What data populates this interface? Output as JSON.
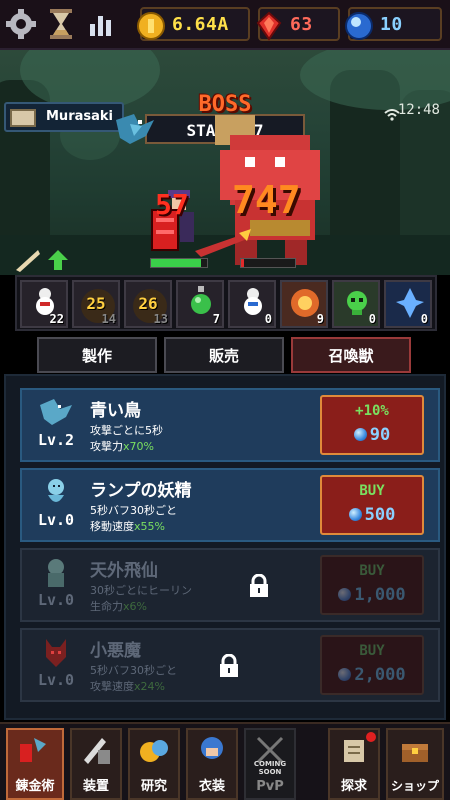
{
  "top_bar": {
    "gold": "6.64A",
    "rubies": "63",
    "gems": "10",
    "icons": [
      "gear-icon",
      "hourglass-icon",
      "stats-icon",
      "gold-coin-icon",
      "ruby-icon",
      "gem-icon"
    ]
  },
  "battle": {
    "player_name": "Murasaki",
    "boss_label": "BOSS",
    "stage_label": "STAGE 17",
    "clock": "12:48",
    "damage_small": "57",
    "damage_large": "747",
    "player_hp_fraction": 0.9,
    "boss_hp_fraction": 0.05
  },
  "items": [
    {
      "name": "snowman-potion",
      "count": "22"
    },
    {
      "name": "gold-coin-25",
      "value": "25",
      "count": "14"
    },
    {
      "name": "gold-coin-26",
      "value": "26",
      "count": "13"
    },
    {
      "name": "green-potion",
      "count": "7"
    },
    {
      "name": "snowman-potion-2",
      "count": "0"
    },
    {
      "name": "fire-scroll",
      "count": "9"
    },
    {
      "name": "skull-scroll",
      "count": "0"
    },
    {
      "name": "ice-scroll",
      "count": "0"
    }
  ],
  "tabs": [
    {
      "label": "製作",
      "active": false
    },
    {
      "label": "販売",
      "active": false
    },
    {
      "label": "召喚獣",
      "active": true
    }
  ],
  "summons": [
    {
      "name": "青い鳥",
      "level": "Lv.2",
      "desc1": "攻撃ごとに5秒",
      "desc2_pre": "攻撃力",
      "desc2_hl": "x70%",
      "btn_top": "+10%",
      "btn_price": "90",
      "locked": false
    },
    {
      "name": "ランプの妖精",
      "level": "Lv.0",
      "desc1": "5秒バフ30秒ごと",
      "desc2_pre": "移動速度",
      "desc2_hl": "x55%",
      "btn_top": "BUY",
      "btn_price": "500",
      "locked": false
    },
    {
      "name": "天外飛仙",
      "level": "Lv.0",
      "desc1": "30秒ごとにヒーリン",
      "desc2_pre": "生命力",
      "desc2_hl": "x6%",
      "btn_top": "BUY",
      "btn_price": "1,000",
      "locked": true
    },
    {
      "name": "小悪魔",
      "level": "Lv.0",
      "desc1": "5秒バフ30秒ごと",
      "desc2_pre": "攻撃速度",
      "desc2_hl": "x24%",
      "btn_top": "BUY",
      "btn_price": "2,000",
      "locked": true
    }
  ],
  "bottom_nav": [
    {
      "label": "錬金術",
      "active": true
    },
    {
      "label": "装置",
      "active": false
    },
    {
      "label": "研究",
      "active": false
    },
    {
      "label": "衣装",
      "active": false
    },
    {
      "label": "PvP",
      "sub": "COMING SOON",
      "active": false
    },
    {
      "label": "探求",
      "active": false
    },
    {
      "label": "ショップ",
      "active": false
    }
  ],
  "colors": {
    "accent": "#e08a3a",
    "highlight": "#7ae060",
    "gem": "#3a8ae0"
  }
}
